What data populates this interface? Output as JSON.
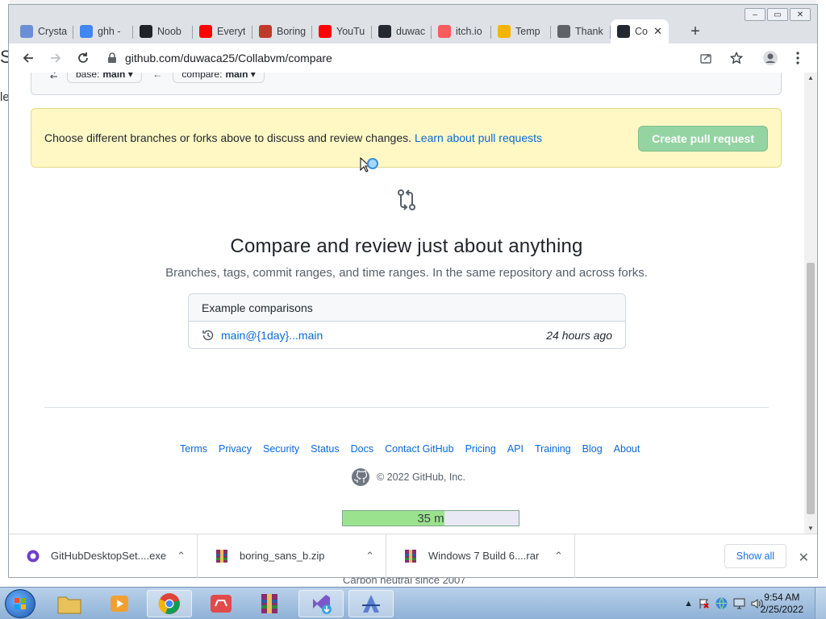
{
  "browser": {
    "tabs": [
      {
        "label": "Crysta",
        "icon": "crystal-icon",
        "color": "#6b8fd6"
      },
      {
        "label": "ghh -",
        "icon": "google-icon",
        "color": "#4285f4"
      },
      {
        "label": "Noob",
        "icon": "noob-icon",
        "color": "#202428"
      },
      {
        "label": "Everyt",
        "icon": "youtube-icon",
        "color": "#ff0000"
      },
      {
        "label": "Boring",
        "icon": "boring-icon",
        "color": "#c0392b"
      },
      {
        "label": "YouTu",
        "icon": "youtube-icon",
        "color": "#ff0000"
      },
      {
        "label": "duwac",
        "icon": "github-icon",
        "color": "#24292f"
      },
      {
        "label": "itch.io",
        "icon": "itchio-icon",
        "color": "#fa5c5c"
      },
      {
        "label": "Temp",
        "icon": "mail-icon",
        "color": "#f4b400"
      },
      {
        "label": "Thank",
        "icon": "globe-icon",
        "color": "#5f6368"
      },
      {
        "label": "Co",
        "icon": "github-icon",
        "color": "#24292f",
        "active": true
      }
    ],
    "address": "github.com/duwaca25/Collabvm/compare"
  },
  "page": {
    "base_label": "base:",
    "base_value": "main",
    "compare_label": "compare:",
    "compare_value": "main",
    "flash_text": "Choose different branches or forks above to discuss and review changes.",
    "flash_link": "Learn about pull requests",
    "create_pr": "Create pull request",
    "blank_title": "Compare and review just about anything",
    "blank_subtitle": "Branches, tags, commit ranges, and time ranges. In the same repository and across forks.",
    "examples_header": "Example comparisons",
    "example_link": "main@{1day}...main",
    "example_time": "24 hours ago"
  },
  "footer": {
    "links": [
      "Terms",
      "Privacy",
      "Security",
      "Status",
      "Docs",
      "Contact GitHub",
      "Pricing",
      "API",
      "Training",
      "Blog",
      "About"
    ],
    "copyright": "© 2022 GitHub, Inc.",
    "timer_text": "35 m",
    "timer_fraction": 0.58
  },
  "downloads": {
    "items": [
      {
        "name": "GitHubDesktopSet....exe",
        "icon": "github-desktop-icon"
      },
      {
        "name": "boring_sans_b.zip",
        "icon": "winrar-icon"
      },
      {
        "name": "Windows 7 Build 6....rar",
        "icon": "winrar-icon"
      }
    ],
    "show_all": "Show all"
  },
  "background": {
    "left_peek_1": "S",
    "left_peek_2": "le",
    "bottom_peek": "Carbon neutral since 2007"
  },
  "taskbar": {
    "time": "9:54 AM",
    "date": "2/25/2022"
  }
}
